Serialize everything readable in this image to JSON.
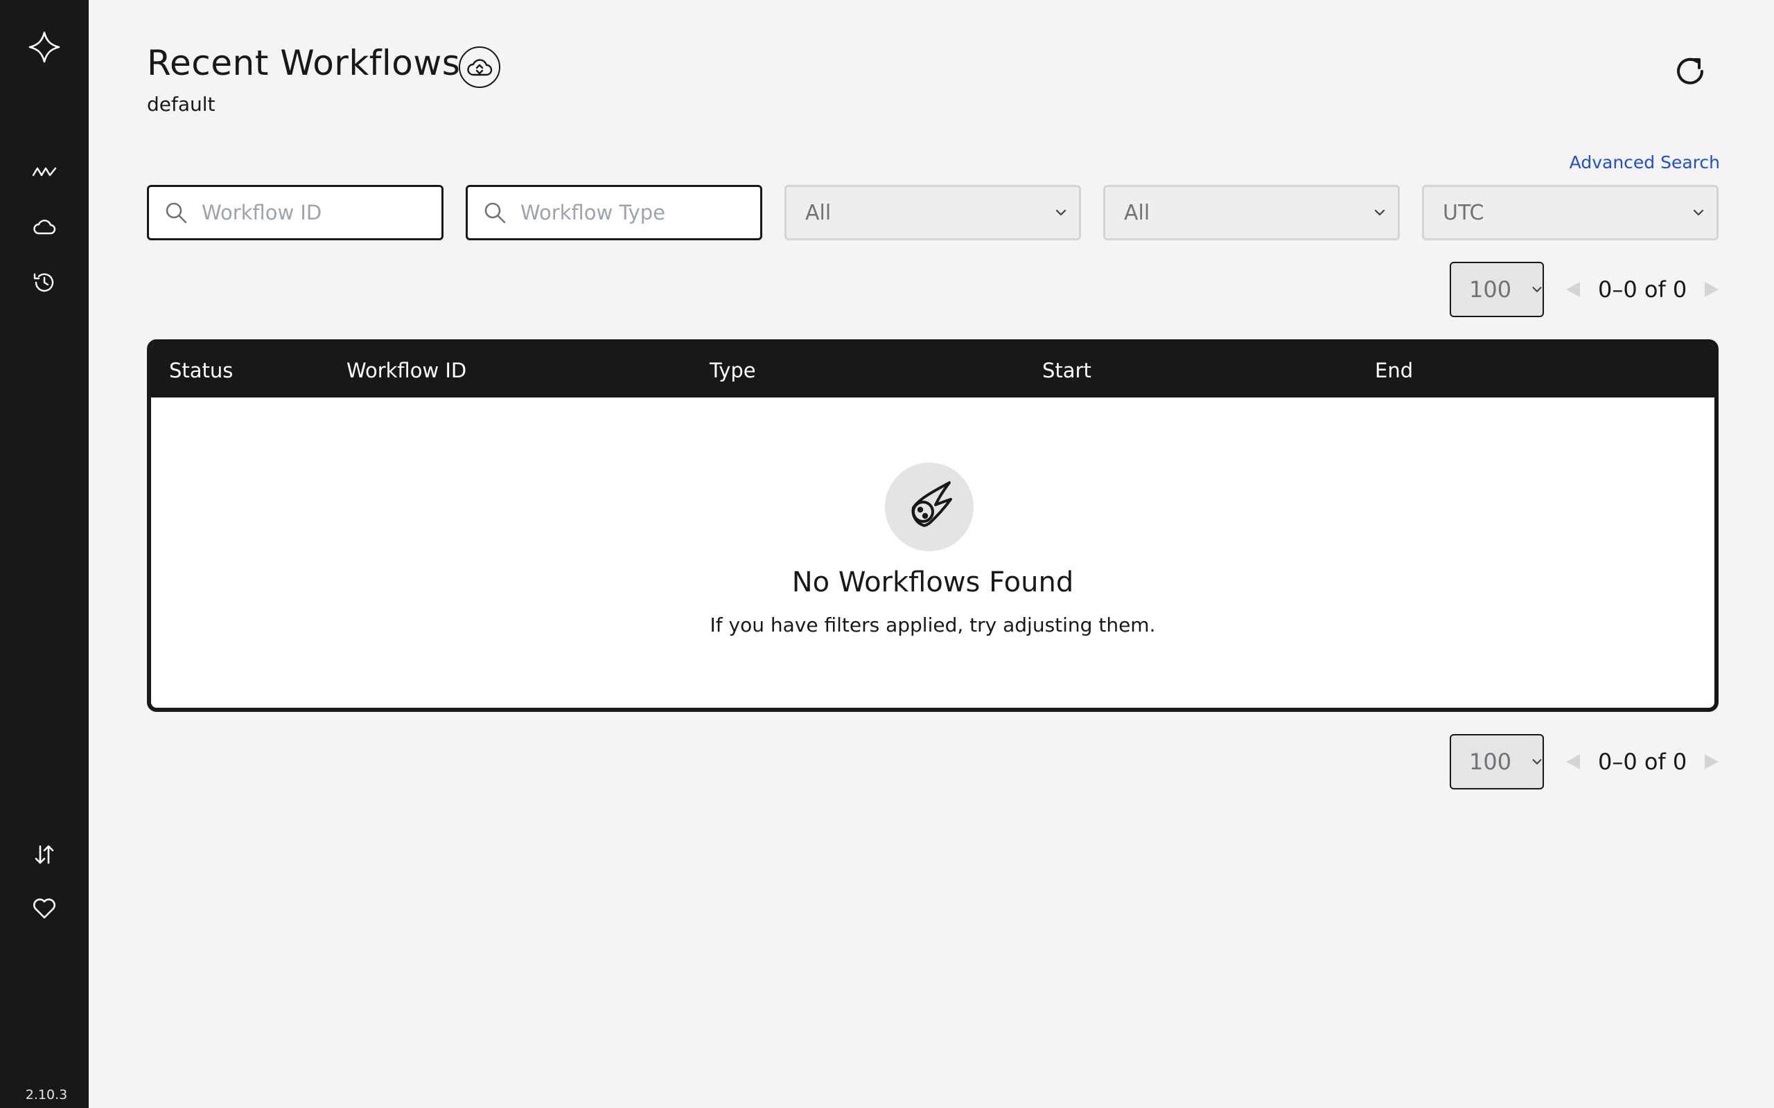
{
  "sidebar": {
    "logo": "temporal-logo-icon",
    "items": [
      {
        "name": "workflows",
        "icon": "pulse-icon"
      },
      {
        "name": "namespaces",
        "icon": "cloud-icon"
      },
      {
        "name": "archival",
        "icon": "history-icon"
      }
    ],
    "bottom_items": [
      {
        "name": "import",
        "icon": "sort-arrows-icon"
      },
      {
        "name": "feedback",
        "icon": "heart-icon"
      }
    ],
    "version": "2.10.3"
  },
  "header": {
    "title": "Recent Workflows",
    "namespace": "default"
  },
  "search": {
    "advanced_link": "Advanced Search",
    "workflow_id_placeholder": "Workflow ID",
    "workflow_type_placeholder": "Workflow Type",
    "execution_status": "All",
    "time_filter": "All",
    "timezone": "UTC"
  },
  "pagination": {
    "page_size": "100",
    "range": "0–0 of 0"
  },
  "table": {
    "columns": [
      "Status",
      "Workflow ID",
      "Type",
      "Start",
      "End"
    ],
    "empty_title": "No Workflows Found",
    "empty_description": "If you have filters applied, try adjusting them."
  },
  "colors": {
    "sidebar_bg": "#18181b",
    "page_bg": "#f4f4f4",
    "link": "#1d4ed8"
  }
}
